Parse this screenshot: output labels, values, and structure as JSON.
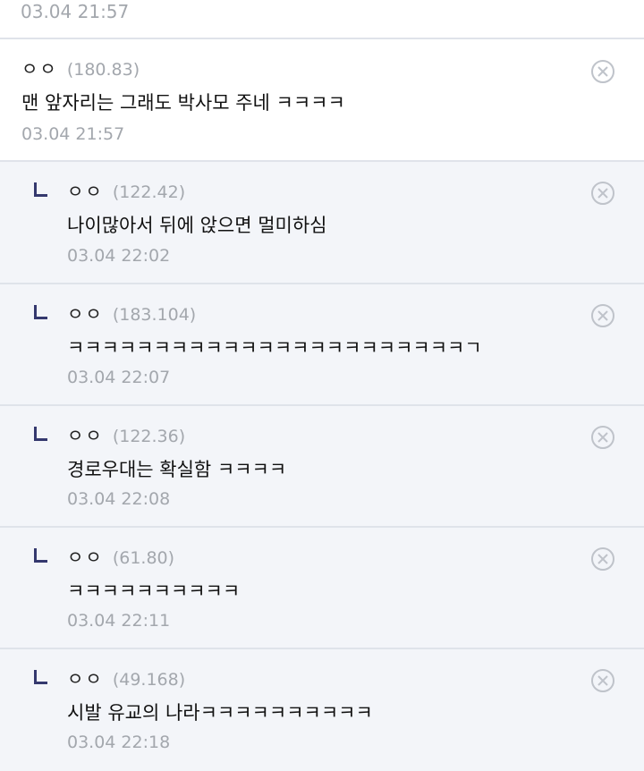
{
  "top_date": "03.04 21:57",
  "comments": [
    {
      "nick": "ㅇㅇ",
      "ip": "(180.83)",
      "text": "맨 앞자리는 그래도 박사모 주네 ㅋㅋㅋㅋ",
      "date": "03.04 21:57"
    },
    {
      "nick": "ㅇㅇ",
      "ip": "(122.42)",
      "text": "나이많아서 뒤에 앉으면 멀미하심",
      "date": "03.04 22:02"
    },
    {
      "nick": "ㅇㅇ",
      "ip": "(183.104)",
      "text": "ㅋㅋㅋㅋㅋㅋㅋㅋㅋㅋㅋㅋㅋㅋㅋㅋㅋㅋㅋㅋㅋㅋㅋㄱ",
      "date": "03.04 22:07"
    },
    {
      "nick": "ㅇㅇ",
      "ip": "(122.36)",
      "text": "경로우대는 확실함 ㅋㅋㅋㅋ",
      "date": "03.04 22:08"
    },
    {
      "nick": "ㅇㅇ",
      "ip": "(61.80)",
      "text": "ㅋㅋㅋㅋㅋㅋㅋㅋㅋㅋ",
      "date": "03.04 22:11"
    },
    {
      "nick": "ㅇㅇ",
      "ip": "(49.168)",
      "text": "시발 유교의 나라ㅋㅋㅋㅋㅋㅋㅋㅋㅋㅋ",
      "date": "03.04 22:18"
    }
  ],
  "icons": {
    "delete": "circle-x-icon",
    "reply": "reply-arrow-icon"
  }
}
